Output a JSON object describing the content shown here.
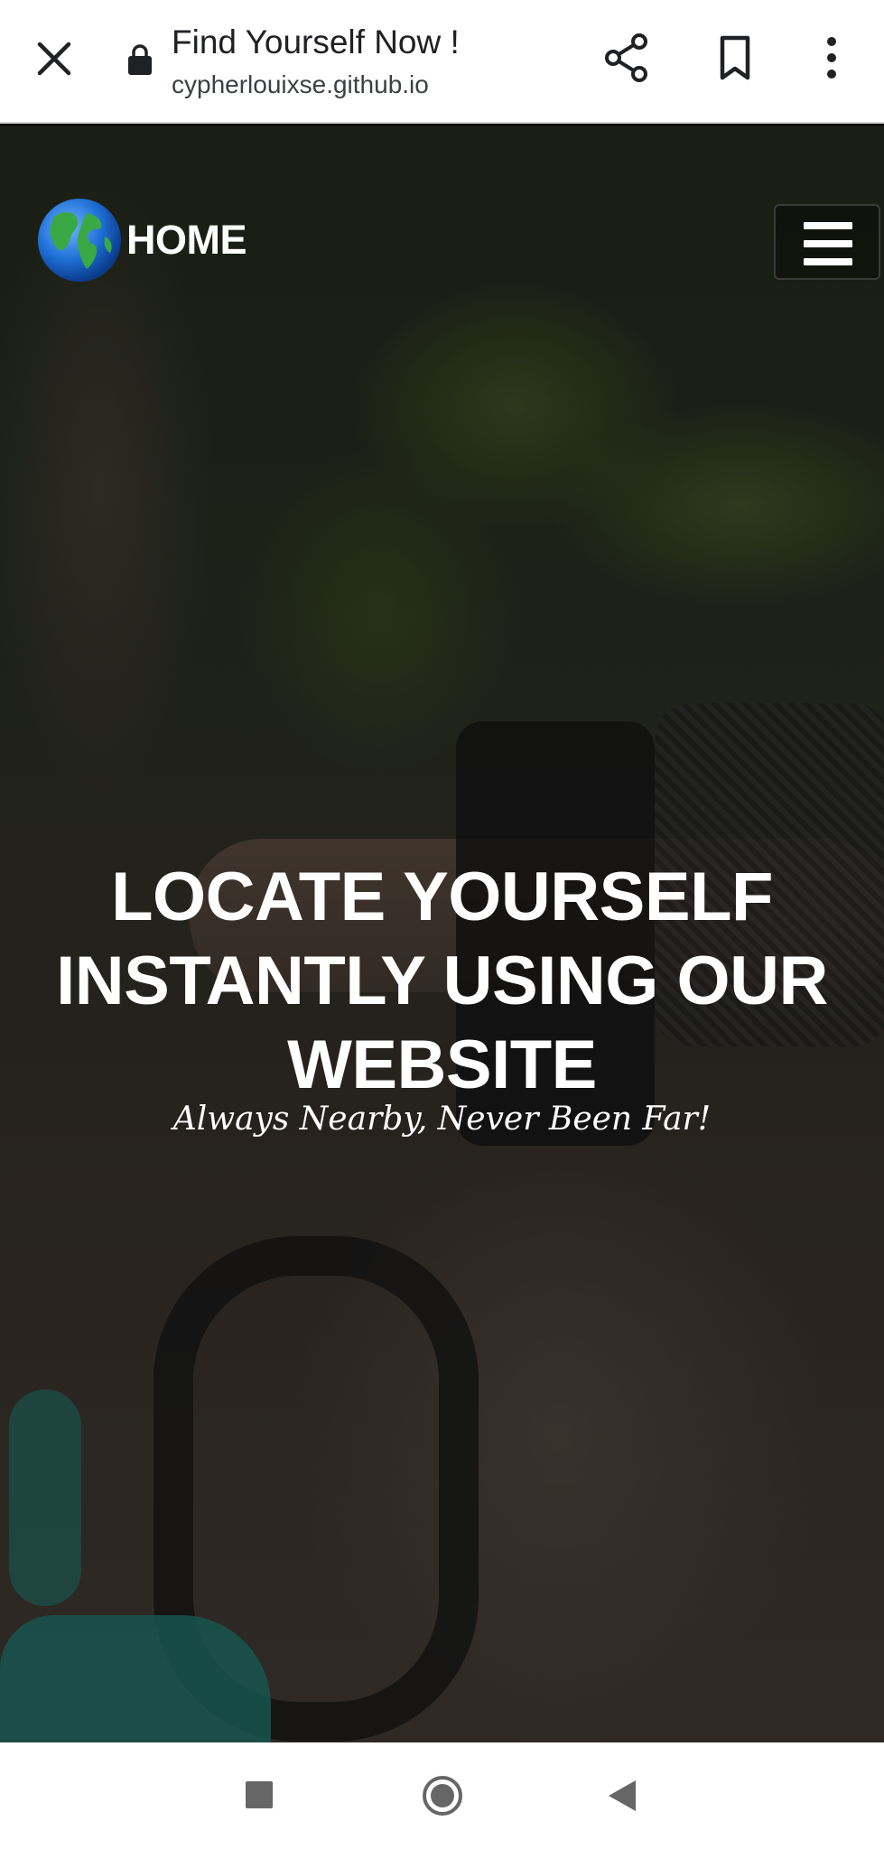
{
  "toolbar": {
    "title": "Find Yourself Now !",
    "url": "cypherlouixse.github.io",
    "icons": [
      "close-icon",
      "lock-icon",
      "share-icon",
      "bookmark-icon",
      "more-vert-icon"
    ]
  },
  "site": {
    "nav_label": "HOME",
    "logo_icon": "globe-icon",
    "menu_icon": "hamburger-icon",
    "heading_lines": [
      "LOCATE YOURSELF",
      "INSTANTLY USING OUR",
      "WEBSITE"
    ],
    "tagline": "Always Nearby, Never Been Far!"
  },
  "system_nav": {
    "icons": [
      "recents-icon",
      "home-icon",
      "back-icon"
    ]
  },
  "colors": {
    "toolbar_bg": "#ffffff",
    "toolbar_text": "#202124",
    "hero_text": "#ffffff",
    "globe_ocean": "#1e6fd6",
    "globe_land": "#3aa845"
  }
}
